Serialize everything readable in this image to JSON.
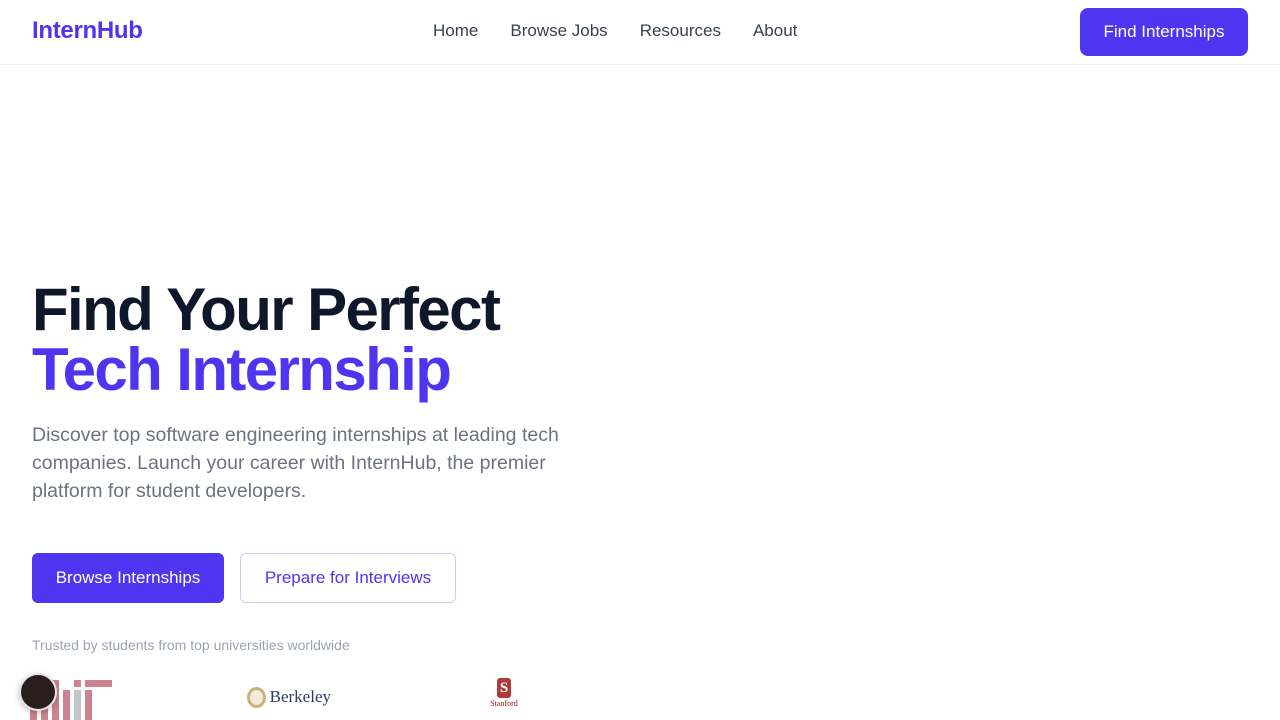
{
  "header": {
    "brand": "InternHub",
    "nav": [
      {
        "label": "Home"
      },
      {
        "label": "Browse Jobs"
      },
      {
        "label": "Resources"
      },
      {
        "label": "About"
      }
    ],
    "cta_label": "Find Internships"
  },
  "hero": {
    "title_line1": "Find Your Perfect",
    "title_line2": "Tech Internship",
    "description": "Discover top software engineering internships at leading tech companies. Launch your career with InternHub, the premier platform for student developers.",
    "primary_button": "Browse Internships",
    "secondary_button": "Prepare for Interviews"
  },
  "trust": {
    "text": "Trusted by students from top universities worldwide",
    "logos": [
      {
        "name": "MIT",
        "icon": "mit-logo"
      },
      {
        "name": "Berkeley",
        "icon": "berkeley-logo"
      },
      {
        "name": "Stanford",
        "icon": "stanford-logo"
      }
    ]
  },
  "colors": {
    "brand": "#4f35f0",
    "heading": "#0f172a",
    "body_text": "#6b7280",
    "muted": "#9ca3af",
    "mit_red": "#a31f34",
    "stanford_red": "#8c1515"
  },
  "widgets": {
    "chat_icon": "chat-bubble-icon"
  }
}
